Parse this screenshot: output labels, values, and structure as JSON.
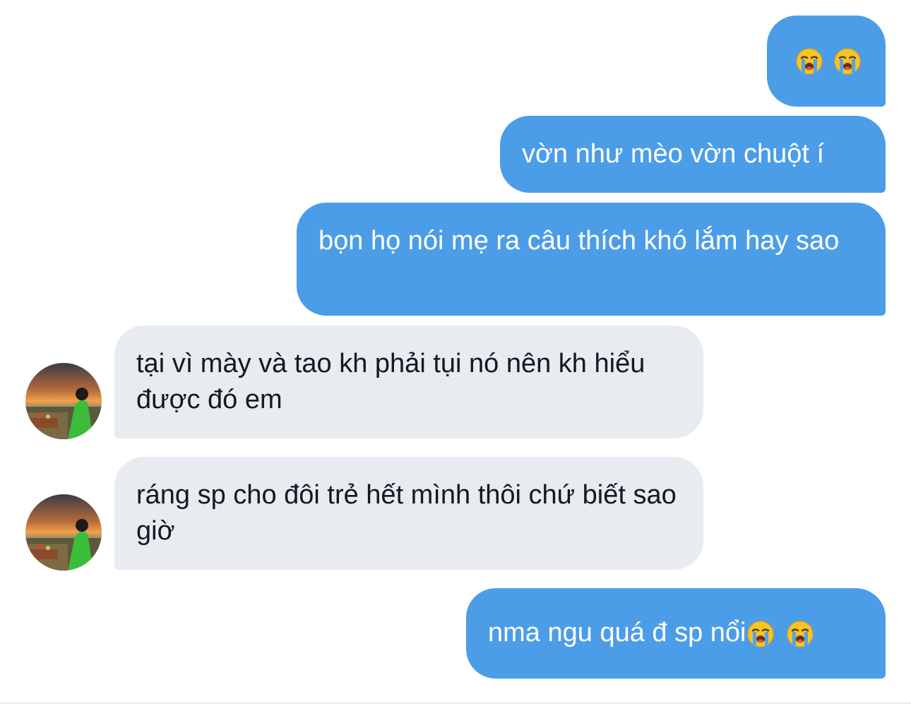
{
  "conversation": {
    "messages": [
      {
        "id": "m1",
        "sender": "me",
        "text": "",
        "emojis": [
          "loudly-crying-face",
          "loudly-crying-face"
        ]
      },
      {
        "id": "m2",
        "sender": "me",
        "text": "vờn như mèo vờn chuột í"
      },
      {
        "id": "m3",
        "sender": "me",
        "text": "bọn họ nói mẹ ra câu thích khó lắm hay sao"
      },
      {
        "id": "m4",
        "sender": "other",
        "text": "tại vì mày và tao kh phải tụi nó nên kh hiểu được đó em"
      },
      {
        "id": "m5",
        "sender": "other",
        "text": "ráng sp cho đôi trẻ hết mình thôi chứ biết sao giờ"
      },
      {
        "id": "m6",
        "sender": "me",
        "text": "nma ngu quá đ sp nổi",
        "emojis": [
          "loudly-crying-face",
          "loudly-crying-face"
        ]
      }
    ]
  },
  "theme": {
    "outgoing_bubble": "#4c9de8",
    "incoming_bubble": "#e8ebef",
    "outgoing_text": "#ffffff",
    "incoming_text": "#141823"
  }
}
